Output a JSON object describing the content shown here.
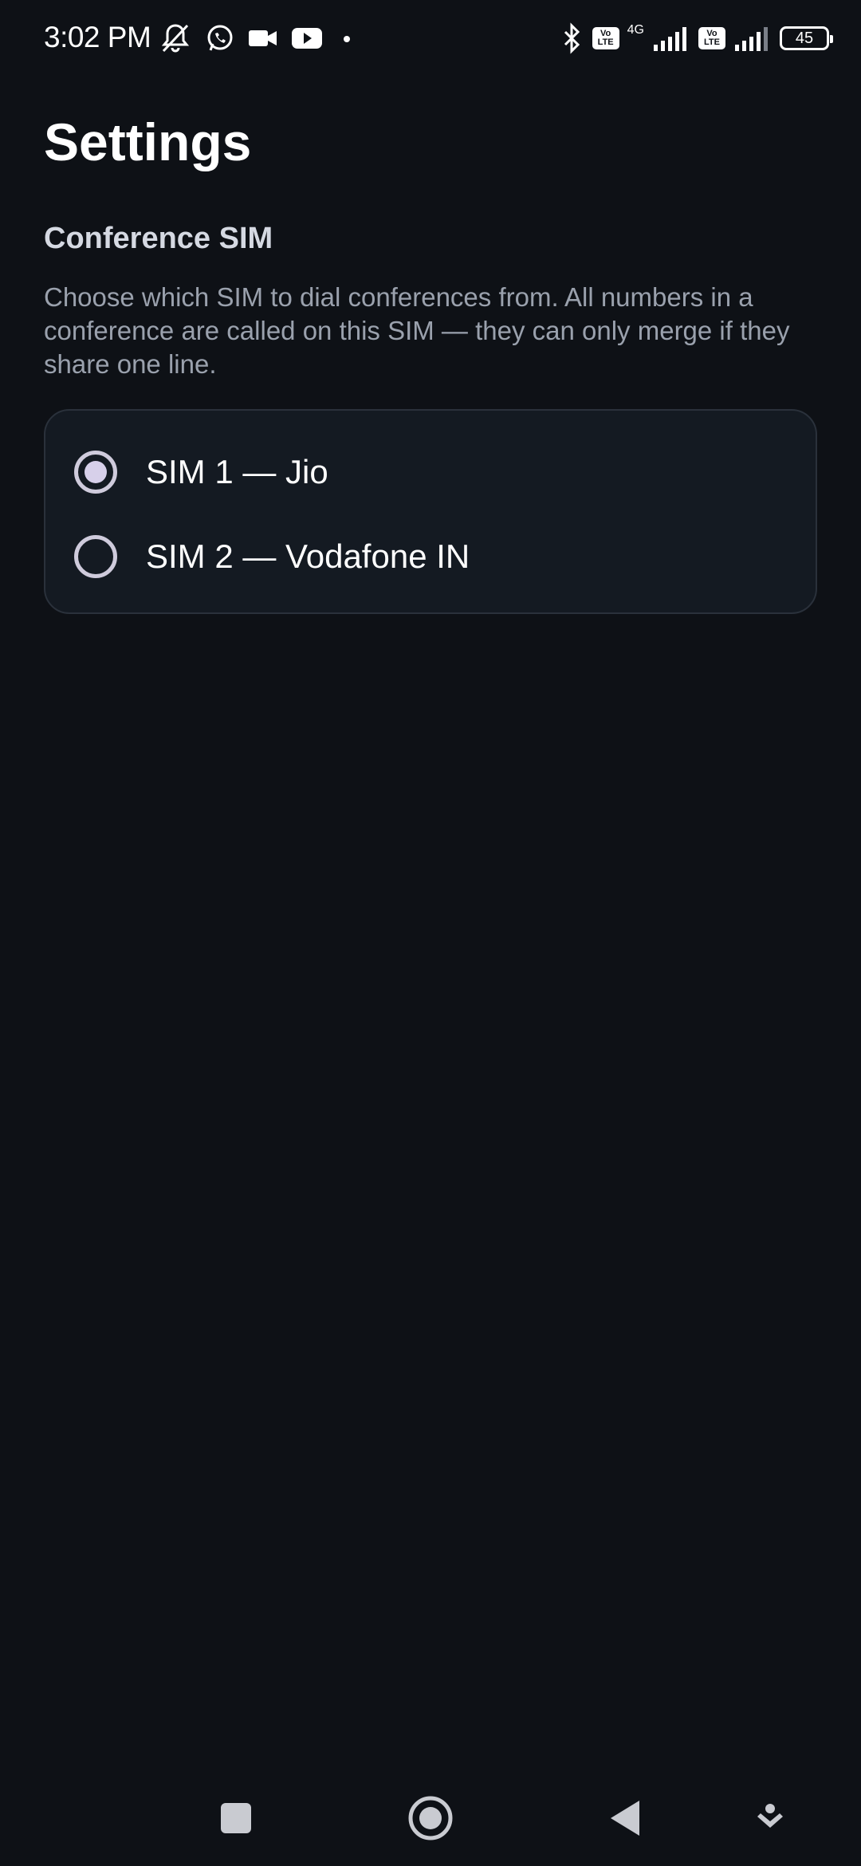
{
  "status_bar": {
    "time": "3:02 PM",
    "network_type": "4G",
    "battery_level": "45",
    "volte_label_top": "Vo",
    "volte_label_bottom": "LTE",
    "left_icons": [
      "bell-off-icon",
      "whatsapp-icon",
      "video-camera-icon",
      "youtube-icon",
      "dot-icon"
    ],
    "right_icons": [
      "bluetooth-icon",
      "volte-icon",
      "signal-icon",
      "volte-icon",
      "signal-icon",
      "battery-icon"
    ]
  },
  "page": {
    "title": "Settings"
  },
  "conference_sim": {
    "title": "Conference SIM",
    "description": "Choose which SIM to dial conferences from. All numbers in a conference are called on this SIM — they can only merge if they share one line.",
    "options": [
      {
        "label": "SIM 1 — Jio",
        "selected": true
      },
      {
        "label": "SIM 2 — Vodafone IN",
        "selected": false
      }
    ]
  },
  "nav_bar": {
    "buttons": [
      "recents-square-icon",
      "home-circle-icon",
      "back-triangle-icon",
      "assist-down-icon"
    ]
  },
  "colors": {
    "background": "#0e1116",
    "card_background": "#141a22",
    "card_border": "#2a313b",
    "radio_accent": "#d7d0ea",
    "description_text": "#9aa1ad"
  }
}
